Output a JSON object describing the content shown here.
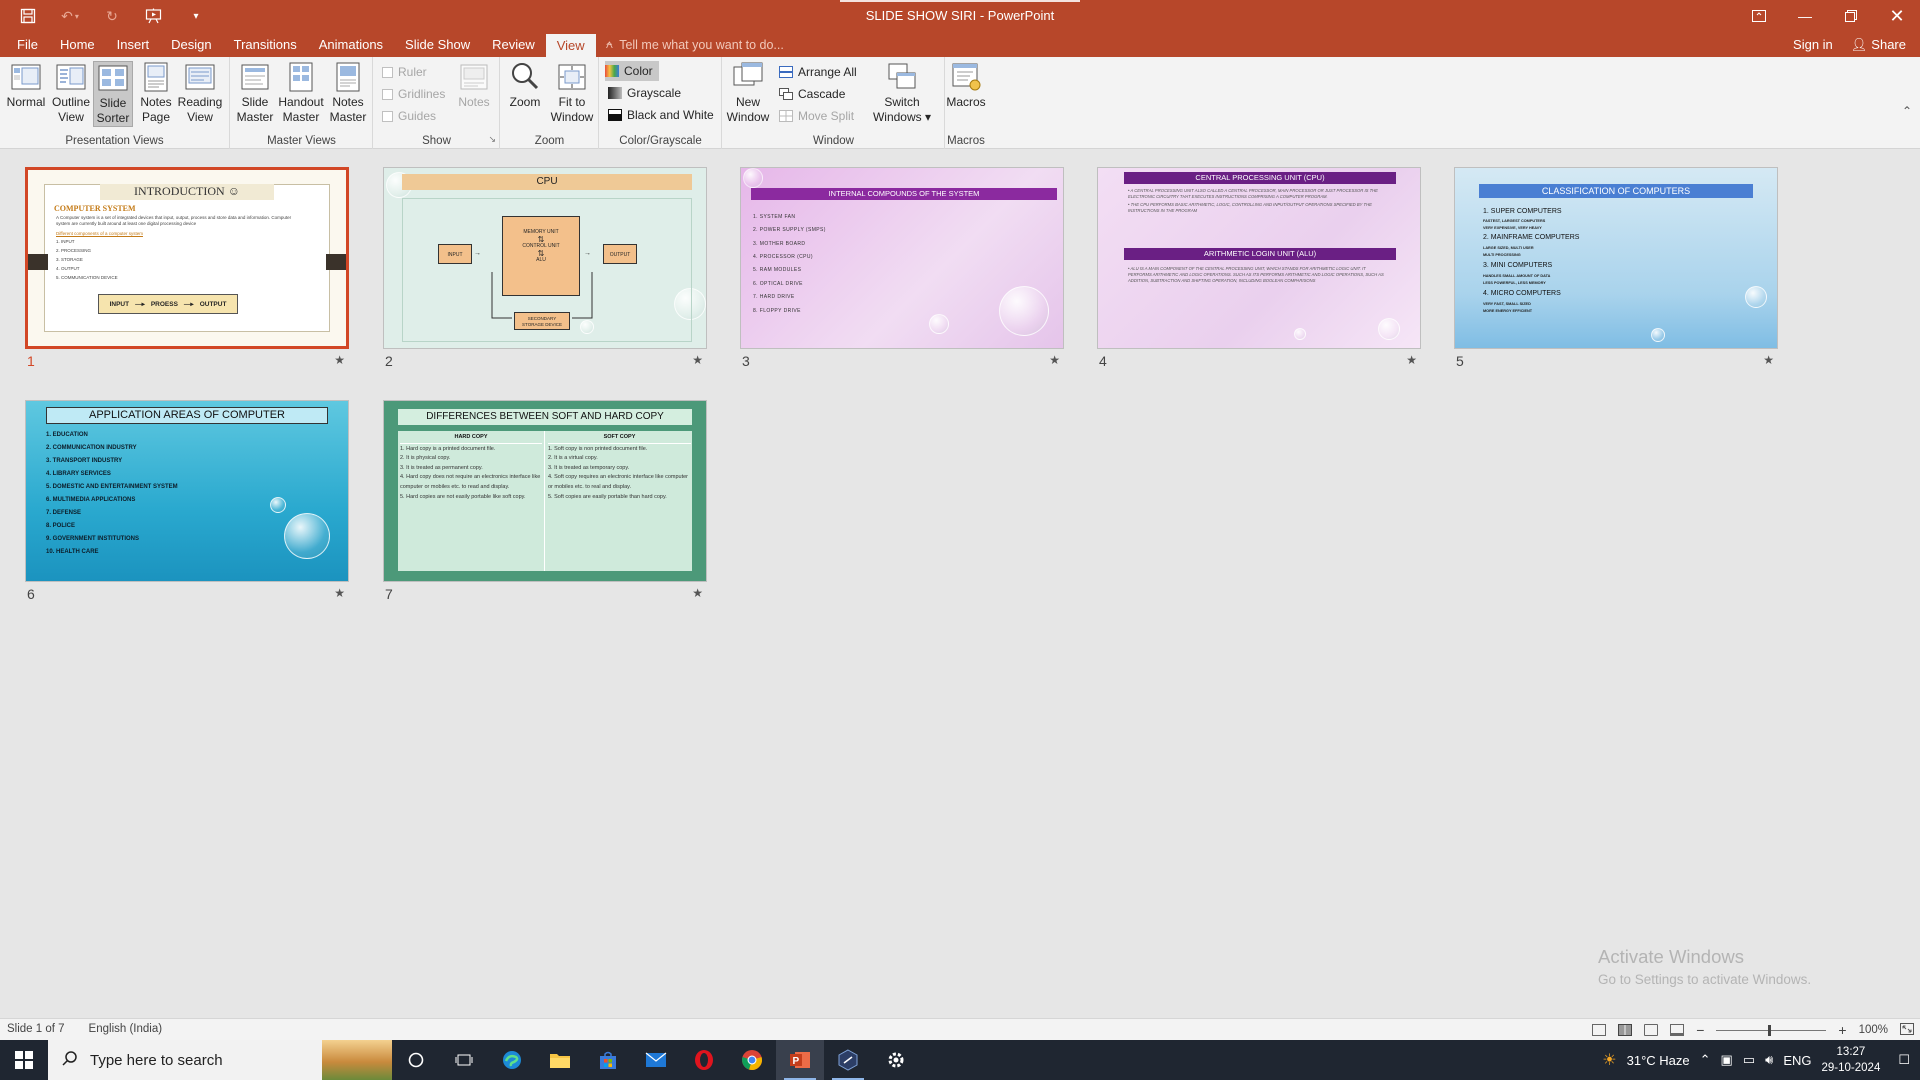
{
  "window": {
    "title": "SLIDE SHOW SIRI - PowerPoint"
  },
  "tabs": [
    "File",
    "Home",
    "Insert",
    "Design",
    "Transitions",
    "Animations",
    "Slide Show",
    "Review",
    "View"
  ],
  "active_tab": "View",
  "tell_me": "Tell me what you want to do...",
  "account": {
    "sign_in": "Sign in",
    "share": "Share"
  },
  "ribbon": {
    "presentation_views": {
      "label": "Presentation Views",
      "normal": "Normal",
      "outline": [
        "Outline",
        "View"
      ],
      "slide_sorter": [
        "Slide",
        "Sorter"
      ],
      "notes_page": [
        "Notes",
        "Page"
      ],
      "reading_view": [
        "Reading",
        "View"
      ]
    },
    "master_views": {
      "label": "Master Views",
      "slide_master": [
        "Slide",
        "Master"
      ],
      "handout_master": [
        "Handout",
        "Master"
      ],
      "notes_master": [
        "Notes",
        "Master"
      ]
    },
    "show": {
      "label": "Show",
      "ruler": "Ruler",
      "gridlines": "Gridlines",
      "guides": "Guides",
      "notes": "Notes"
    },
    "zoom": {
      "label": "Zoom",
      "zoom": "Zoom",
      "fit": [
        "Fit to",
        "Window"
      ]
    },
    "color": {
      "label": "Color/Grayscale",
      "color": "Color",
      "grayscale": "Grayscale",
      "bw": "Black and White"
    },
    "window": {
      "label": "Window",
      "new_window": [
        "New",
        "Window"
      ],
      "arrange_all": "Arrange All",
      "cascade": "Cascade",
      "move_split": "Move Split",
      "switch": [
        "Switch",
        "Windows ▾"
      ]
    },
    "macros": {
      "label": "Macros",
      "macros": "Macros"
    }
  },
  "slides": [
    {
      "number": "1",
      "title": "INTRODUCTION ☺",
      "subtitle": "COMPUTER SYSTEM",
      "body": "A Computer system is a set of integrated devices that input, output, process and store data and information. Computer system are currently built around at least one digital processing device",
      "link": "Different components of a computer system",
      "items": [
        "1. INPUT",
        "2. PROCESSING",
        "3. STORAGE",
        "4. OUTPUT",
        "5. COMMUNICATION DEVICE"
      ],
      "flow": [
        "INPUT",
        "PROESS",
        "OUTPUT"
      ]
    },
    {
      "number": "2",
      "title": "CPU",
      "input": "INPUT",
      "output": "OUTPUT",
      "memory": "MEMORY UNIT",
      "control": "CONTROL UNIT",
      "alu": "ALU",
      "storage": [
        "SECONDARY",
        "STORAGE DEVICE"
      ]
    },
    {
      "number": "3",
      "title": "INTERNAL COMPOUNDS OF THE SYSTEM",
      "items": [
        "1.   SYSTEM FAN",
        "2.   POWER SUPPLY (SMPS)",
        "3.   MOTHER BOARD",
        "4.   PROCESSOR (CPU)",
        "5.   RAM MODULES",
        "6.   OPTICAL DRIVE",
        "7.   HARD DRIVE",
        "8.   FLOPPY DRIVE"
      ]
    },
    {
      "number": "4",
      "title1": "CENTRAL PROCESSING UNIT (CPU)",
      "text1a": "• A CENTRAL PROCESSING UNIT ALSO CALLED A CENTRAL PROCESSOR, MAIN PROCESSOR OR JUST PROCESSOR IS THE ELECTRONIC CIRCUITRY THAT EXECUTES INSTRUCTIONS COMPRISING A COMPUTER PROGRAM.",
      "text1b": "• THE CPU PERFORMS BASIC ARITHMETIC, LOGIC, CONTROLLING AND INPUT/OUTPUT OPERATIONS SPECIFIED BY THE INSTRUCTIONS IN THE PROGRAM",
      "title2": "ARITHMETIC LOGIN UNIT (ALU)",
      "text2": "• ALU IS A MAIN COMPONENT OF THE CENTRAL PROCESSING UNIT, WHICH STANDS FOR ARITHMETIC LOGIC UNIT. IT PERFORMS ARITHMETIC AND LOGIC OPERATIONS. SUCH AS ITS PERFORMS ARITHMETIC AND LOGIC OPERATIONS, SUCH AS ADDITION, SUBTRACTION AND SHIFTING OPERATION, INCLUDING BOOLEAN COMPARISONS"
    },
    {
      "number": "5",
      "title": "CLASSIFICATION OF COMPUTERS",
      "groups": [
        {
          "head": "1.  SUPER COMPUTERS",
          "sub": [
            "FASTEST, LARGEST COMPUTERS",
            "VERY EXPENSIVE, VERY HEAVY"
          ]
        },
        {
          "head": "2. MAINFRAME COMPUTERS",
          "sub": [
            "LARGE SIZED, MULTI USER",
            "MULTI PROCESSING"
          ]
        },
        {
          "head": "3. MINI COMPUTERS",
          "sub": [
            "HANDLES SMALL AMOUNT OF DATA",
            "LESS POWERFUL, LESS MEMORY"
          ]
        },
        {
          "head": "4. MICRO COMPUTERS",
          "sub": [
            "VERY FAST, SMALL SIZED",
            "MORE ENERGY EFFICIENT"
          ]
        }
      ]
    },
    {
      "number": "6",
      "title": "APPLICATION AREAS OF COMPUTER",
      "items": [
        "1. EDUCATION",
        "2. COMMUNICATION INDUSTRY",
        "3. TRANSPORT INDUSTRY",
        "4. LIBRARY SERVICES",
        "5. DOMESTIC AND ENTERTAINMENT SYSTEM",
        "6. MULTIMEDIA APPLICATIONS",
        "7. DEFENSE",
        "8. POLICE",
        "9. GOVERNMENT INSTITUTIONS",
        "10. HEALTH CARE"
      ]
    },
    {
      "number": "7",
      "title": "DIFFERENCES BETWEEN SOFT AND HARD COPY",
      "hard_head": "HARD COPY",
      "soft_head": "SOFT COPY",
      "hard": [
        "1. Hard copy is a printed document file.",
        "2. It is physical copy.",
        "3. It is treated as permanent copy.",
        "4. Hard copy does not require an electronics interface like computer or mobiles etc. to read and display.",
        "5. Hard copies are not easily portable like soft copy."
      ],
      "soft": [
        "1. Soft copy is non printed document file.",
        "2. It is a virtual copy.",
        "3. It is treated as temporary copy.",
        "4. Soft copy requires an electronic interface like computer or mobiles etc. to real and display.",
        "5. Soft copies are easily portable than hard copy."
      ]
    }
  ],
  "slide_star": "★",
  "watermark": {
    "line1": "Activate Windows",
    "line2": "Go to Settings to activate Windows."
  },
  "status": {
    "slide_of": "Slide 1 of 7",
    "language": "English (India)",
    "zoom": "100%"
  },
  "taskbar": {
    "search_placeholder": "Type here to search",
    "weather": "31°C  Haze",
    "lang": "ENG",
    "time": "13:27",
    "date": "29-10-2024"
  },
  "colors": {
    "accent": "#b7472a",
    "selected_border": "#d24726"
  }
}
